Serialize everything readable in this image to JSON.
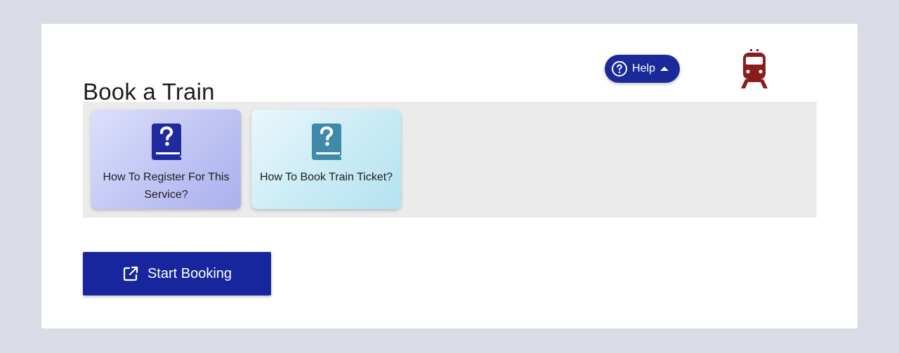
{
  "page": {
    "title": "Book a Train"
  },
  "help_button": {
    "label": "Help",
    "icon": "help-circle-icon",
    "caret_icon": "caret-up-icon"
  },
  "header_icon": "train-icon",
  "faq_cards": [
    {
      "label": "How To Register For This Service?",
      "icon": "help-book-icon"
    },
    {
      "label": "How To Book Train Ticket?",
      "icon": "help-book-icon"
    }
  ],
  "start_button": {
    "label": "Start Booking",
    "icon": "open-external-icon"
  },
  "colors": {
    "background": "#d9dce4",
    "card": "#ffffff",
    "primary": "#17269c",
    "train": "#8b1c1c",
    "faq_strip": "#ebebeb",
    "faq_card_1": "#bfc4f3",
    "faq_card_2": "#c9ebf5",
    "book_icon_1": "#1e2a9e",
    "book_icon_2": "#3f8aa8"
  }
}
